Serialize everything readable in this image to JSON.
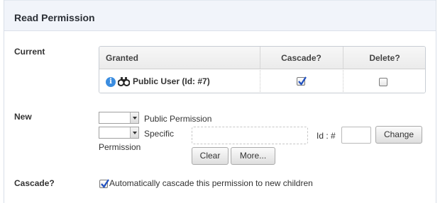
{
  "panel": {
    "title": "Read Permission"
  },
  "current": {
    "label": "Current",
    "columns": {
      "granted": "Granted",
      "cascade": "Cascade?",
      "delete": "Delete?"
    },
    "rows": [
      {
        "granted": "Public User (Id: #7)",
        "cascade": true,
        "delete": false
      }
    ]
  },
  "new_perm": {
    "label": "New",
    "public_select": "",
    "public_label": "Public Permission",
    "specific_select": "",
    "specific_label": "Specific",
    "permission_label": "Permission",
    "id_label": "Id : #",
    "id_value": "",
    "change_button": "Change",
    "clear_button": "Clear",
    "more_button": "More..."
  },
  "cascade": {
    "label": "Cascade?",
    "checked": true,
    "text": "Automatically cascade this permission to new children"
  },
  "colors": {
    "header_bg": "#f1f4fa",
    "info_blue": "#3b8de0",
    "check_blue": "#1f4fbf"
  },
  "icons": [
    "info-icon",
    "binoculars-icon",
    "checkmark-icon",
    "dropdown-arrow-icon"
  ]
}
